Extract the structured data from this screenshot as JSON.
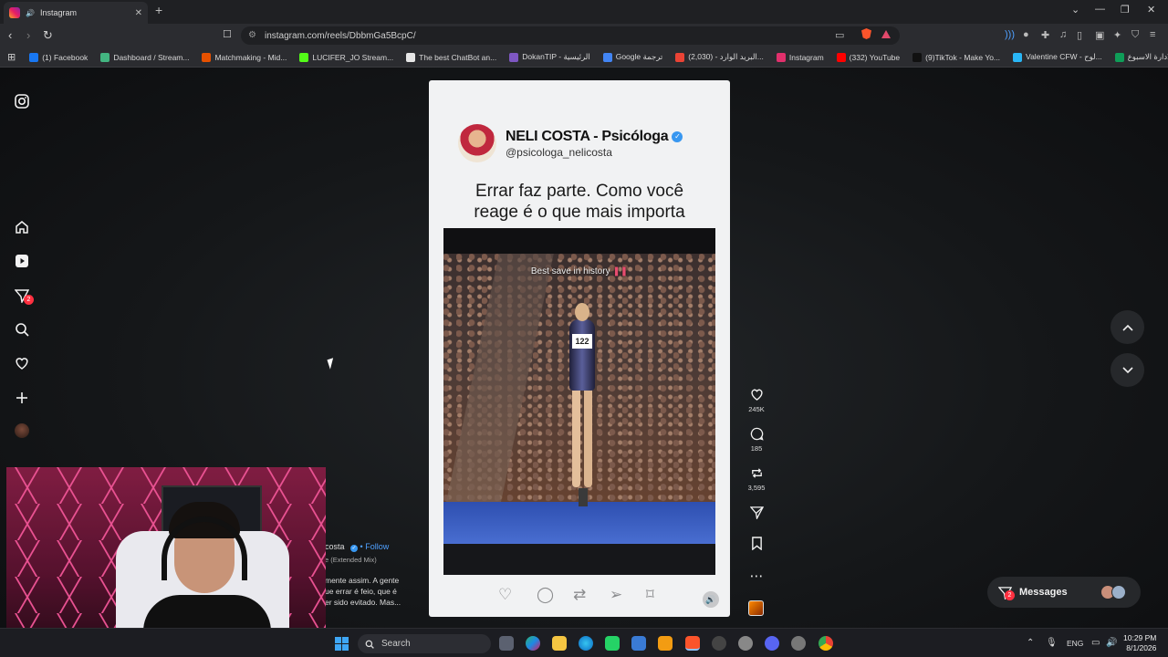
{
  "browser": {
    "tab_title": "Instagram",
    "tab_close": "✕",
    "new_tab": "+",
    "url": "instagram.com/reels/DbbmGa5BcpC/",
    "bookmarks": [
      {
        "label": "(1) Facebook",
        "color": "#1877f2"
      },
      {
        "label": "Dashboard / Stream...",
        "color": "#43b581"
      },
      {
        "label": "Matchmaking - Mid...",
        "color": "#e65100"
      },
      {
        "label": "LUCIFER_JO Stream...",
        "color": "#53fc18"
      },
      {
        "label": "The best ChatBot an...",
        "color": "#e6e6e6"
      },
      {
        "label": "DokanTIP - الرئيسية",
        "color": "#7e57c2"
      },
      {
        "label": "Google ترجمة",
        "color": "#4285f4"
      },
      {
        "label": "البريد الوارد - (2,030)...",
        "color": "#ea4335"
      },
      {
        "label": "Instagram",
        "color": "#e1306c"
      },
      {
        "label": "(332) YouTube",
        "color": "#ff0000"
      },
      {
        "label": "(9)TikTok - Make Yo...",
        "color": "#111111"
      },
      {
        "label": "Valentine CFW - لوح...",
        "color": "#29b6f6"
      },
      {
        "label": "حسبة الادارة الاسبوع...",
        "color": "#0f9d58"
      }
    ]
  },
  "reel": {
    "author_name": "NELI COSTA - Psicóloga",
    "author_handle": "@psicologa_nelicosta",
    "caption_line1": "Errar faz parte. Como você",
    "caption_line2": "reage é o que mais importa",
    "video_overlay": "Best save in history",
    "bib_number": "122"
  },
  "actions": {
    "likes": "245K",
    "comments": "185",
    "reposts": "3,595"
  },
  "under_post": {
    "author_fragment": "costa",
    "follow": "• Follow",
    "music": "e (Extended Mix)",
    "desc_line1": "mente assim. A gente",
    "desc_line2": "ue errar é feio, que é",
    "desc_line3": "er sido evitado. Mas..."
  },
  "sidebar": {
    "notifications_badge": "2"
  },
  "messages": {
    "label": "Messages",
    "badge": "2"
  },
  "taskbar": {
    "search_placeholder": "Search",
    "language": "ENG",
    "time": "10:29 PM",
    "date": "8/1/2026"
  }
}
